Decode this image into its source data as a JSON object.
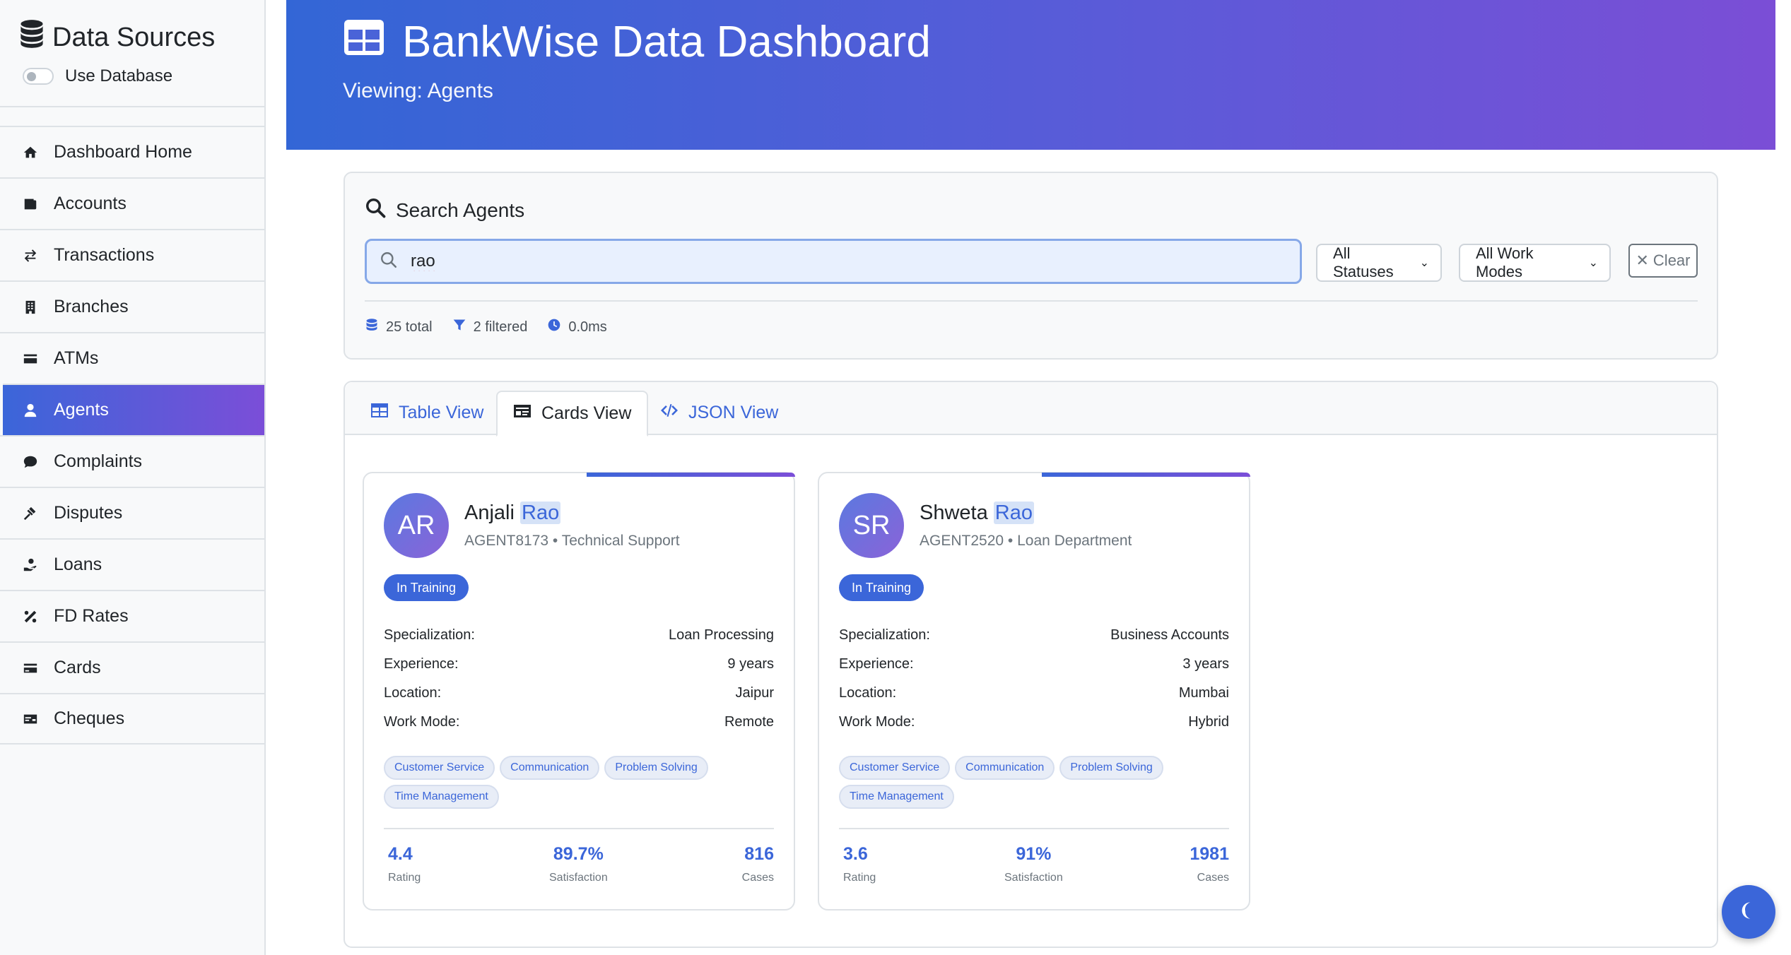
{
  "sidebar": {
    "title": "Data Sources",
    "toggle_label": "Use Database",
    "items": [
      {
        "label": "Dashboard Home",
        "icon": "home-icon"
      },
      {
        "label": "Accounts",
        "icon": "wallet-icon"
      },
      {
        "label": "Transactions",
        "icon": "exchange-icon"
      },
      {
        "label": "Branches",
        "icon": "building-icon"
      },
      {
        "label": "ATMs",
        "icon": "card-icon"
      },
      {
        "label": "Agents",
        "icon": "user-icon",
        "active": true
      },
      {
        "label": "Complaints",
        "icon": "comment-icon"
      },
      {
        "label": "Disputes",
        "icon": "gavel-icon"
      },
      {
        "label": "Loans",
        "icon": "hand-holding-icon"
      },
      {
        "label": "FD Rates",
        "icon": "percent-icon"
      },
      {
        "label": "Cards",
        "icon": "credit-card-icon"
      },
      {
        "label": "Cheques",
        "icon": "money-check-icon"
      }
    ]
  },
  "header": {
    "title": "BankWise Data Dashboard",
    "subtitle": "Viewing: Agents"
  },
  "search": {
    "title": "Search Agents",
    "query": "rao",
    "status_filter": "All Statuses",
    "workmode_filter": "All Work Modes",
    "clear_label": "Clear",
    "stats": {
      "total": "25 total",
      "filtered": "2 filtered",
      "time": "0.0ms"
    }
  },
  "tabs": [
    {
      "label": "Table View",
      "active": false
    },
    {
      "label": "Cards View",
      "active": true
    },
    {
      "label": "JSON View",
      "active": false
    }
  ],
  "agents": [
    {
      "initials": "AR",
      "first_name": "Anjali",
      "last_name": "Rao",
      "subtitle": "AGENT8173 • Technical Support",
      "status": "In Training",
      "details": [
        {
          "label": "Specialization:",
          "value": "Loan Processing"
        },
        {
          "label": "Experience:",
          "value": "9 years"
        },
        {
          "label": "Location:",
          "value": "Jaipur"
        },
        {
          "label": "Work Mode:",
          "value": "Remote"
        }
      ],
      "skills": [
        "Customer Service",
        "Communication",
        "Problem Solving",
        "Time Management"
      ],
      "metrics": [
        {
          "value": "4.4",
          "label": "Rating"
        },
        {
          "value": "89.7%",
          "label": "Satisfaction"
        },
        {
          "value": "816",
          "label": "Cases"
        }
      ]
    },
    {
      "initials": "SR",
      "first_name": "Shweta",
      "last_name": "Rao",
      "subtitle": "AGENT2520 • Loan Department",
      "status": "In Training",
      "details": [
        {
          "label": "Specialization:",
          "value": "Business Accounts"
        },
        {
          "label": "Experience:",
          "value": "3 years"
        },
        {
          "label": "Location:",
          "value": "Mumbai"
        },
        {
          "label": "Work Mode:",
          "value": "Hybrid"
        }
      ],
      "skills": [
        "Customer Service",
        "Communication",
        "Problem Solving",
        "Time Management"
      ],
      "metrics": [
        {
          "value": "3.6",
          "label": "Rating"
        },
        {
          "value": "91%",
          "label": "Satisfaction"
        },
        {
          "value": "1981",
          "label": "Cases"
        }
      ]
    }
  ],
  "theme_toggle_icon": "moon-icon",
  "colors": {
    "accent": "#3b66d9",
    "accent_end": "#7b4ed8"
  }
}
